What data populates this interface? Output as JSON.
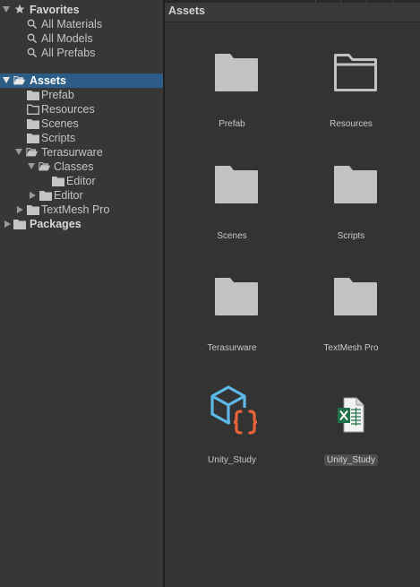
{
  "tree": {
    "favorites": {
      "label": "Favorites",
      "items": [
        "All Materials",
        "All Models",
        "All Prefabs"
      ]
    },
    "assets": {
      "label": "Assets",
      "children": [
        "Prefab",
        "Resources",
        "Scenes",
        "Scripts"
      ],
      "terasurware": {
        "label": "Terasurware",
        "classes": {
          "label": "Classes",
          "children": [
            "Editor"
          ]
        },
        "editor": "Editor"
      },
      "textmesh": "TextMesh Pro"
    },
    "packages": {
      "label": "Packages"
    }
  },
  "panel": {
    "title": "Assets",
    "items": [
      {
        "label": "Prefab",
        "icon": "folder-icon"
      },
      {
        "label": "Resources",
        "icon": "empty-folder-icon"
      },
      {
        "label": "Scenes",
        "icon": "folder-icon"
      },
      {
        "label": "Scripts",
        "icon": "folder-icon"
      },
      {
        "label": "Terasurware",
        "icon": "folder-icon"
      },
      {
        "label": "TextMesh Pro",
        "icon": "folder-icon"
      },
      {
        "label": "Unity_Study",
        "icon": "csharp-project-icon"
      },
      {
        "label": "Unity_Study",
        "icon": "excel-file-icon"
      }
    ]
  },
  "colors": {
    "selection": "#2c5d87",
    "folder": "#c2c2c2",
    "project_blue": "#5db8e8",
    "braces_orange": "#e8633a",
    "excel_green": "#1e7145"
  }
}
